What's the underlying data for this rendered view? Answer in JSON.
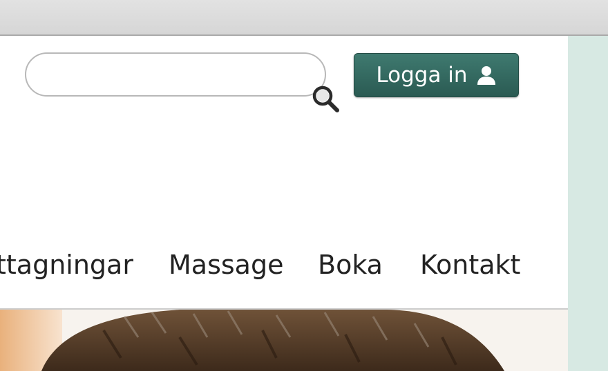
{
  "search": {
    "placeholder": ""
  },
  "header": {
    "login_label": "Logga in"
  },
  "nav": {
    "items": [
      {
        "label": "ttagningar"
      },
      {
        "label": "Massage"
      },
      {
        "label": "Boka"
      },
      {
        "label": "Kontakt"
      }
    ]
  },
  "icons": {
    "search": "search-icon",
    "user": "user-icon"
  },
  "colors": {
    "accent": "#2f6a60",
    "side_panel": "#d7e9e3",
    "nav_text": "#222222"
  }
}
